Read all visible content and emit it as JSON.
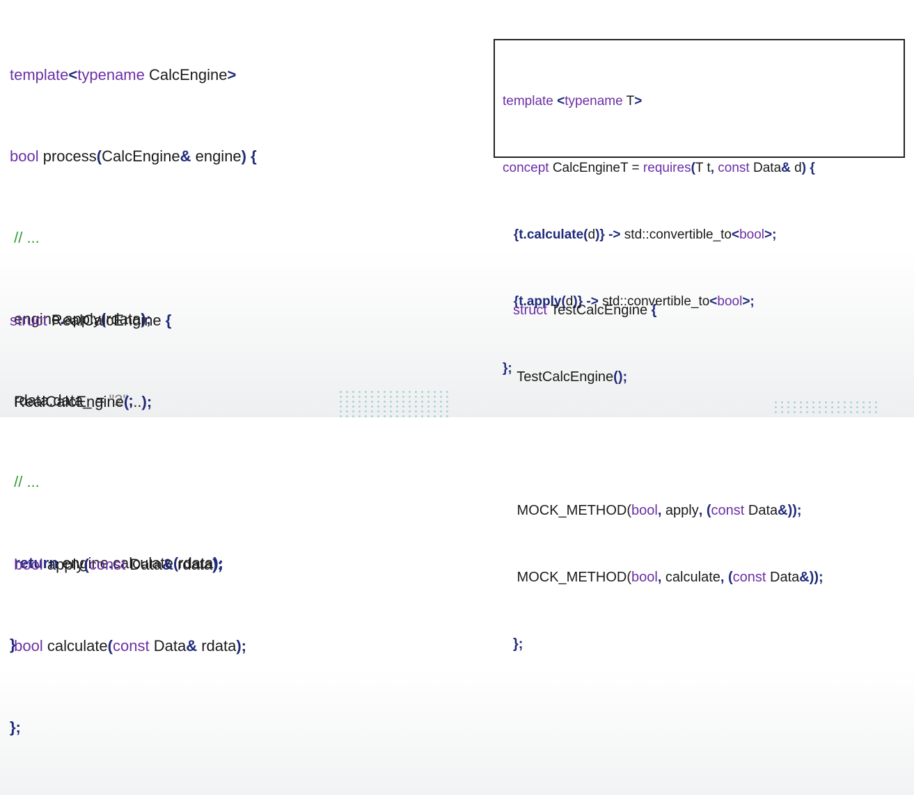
{
  "process_fn": {
    "l1": {
      "a": "template",
      "b": "<",
      "c": "typename",
      "d": " CalcEngine",
      "e": ">"
    },
    "l2": {
      "a": "bool",
      "b": " process",
      "c": "(",
      "d": "CalcEngine",
      "e": "&",
      "f": " engine",
      "g": ") {"
    },
    "l3": {
      "a": " // ..."
    },
    "l4": {
      "a": " engine",
      "b": ".",
      "c": "apply",
      "d": "(",
      "e": "rdata",
      "f": ");"
    },
    "l5": {
      "a": " rdata.data_ = ",
      "b": "\"2\"",
      "c": ";"
    },
    "l6": {
      "a": " // ..."
    },
    "l7": {
      "a": " return",
      "b": " engine",
      "c": ".",
      "d": "calculate",
      "e": "(",
      "f": "rdata",
      "g": ");"
    },
    "l8": {
      "a": "}"
    }
  },
  "concept_box": {
    "l1": {
      "a": "template ",
      "b": "<",
      "c": "typename",
      "d": " T",
      "e": ">"
    },
    "l2": {
      "a": "concept",
      "b": " CalcEngineT = ",
      "c": "requires",
      "d": "(",
      "e": "T t",
      "f": ", ",
      "g": "const",
      "h": " Data",
      "i": "&",
      "j": " d",
      "k": ") {"
    },
    "l3": {
      "a": "   {",
      "b": "t.calculate",
      "c": "(",
      "d": "d",
      "e": ")}",
      "f": " -> ",
      "g": "std::convertible_to",
      "h": "<",
      "i": "bool",
      "j": ">;"
    },
    "l4": {
      "a": "   {",
      "b": "t.apply",
      "c": "(",
      "d": "d",
      "e": ")}",
      "f": " -> ",
      "g": "std::convertible_to",
      "h": "<",
      "i": "bool",
      "j": ">;"
    },
    "l5": {
      "a": "};"
    }
  },
  "real_engine": {
    "l1": {
      "a": "struct",
      "b": " RealCalcEngine ",
      "c": "{"
    },
    "l2": {
      "a": " RealCalcEngine",
      "b": "(",
      "c": "...",
      "d": ");"
    },
    "l3": {
      "a": " "
    },
    "l4": {
      "a": " bool",
      "b": " apply",
      "c": "(",
      "d": "const",
      "e": " Data",
      "f": "&",
      "g": " rdata",
      "h": ");"
    },
    "l5": {
      "a": " bool",
      "b": " calculate",
      "c": "(",
      "d": "const",
      "e": " Data",
      "f": "&",
      "g": " rdata",
      "h": ");"
    },
    "l6": {
      "a": "};"
    }
  },
  "test_engine": {
    "l1": {
      "a": "struct",
      "b": " TestCalcEngine ",
      "c": "{"
    },
    "l2": {
      "a": " TestCalcEngine",
      "b": "();"
    },
    "l3": {
      "a": " "
    },
    "l4": {
      "a": " MOCK_METHOD(",
      "b": "bool",
      "c": ",",
      "d": " apply",
      "e": ", (",
      "f": "const",
      "g": " Data",
      "h": "&));"
    },
    "l5": {
      "a": " MOCK_METHOD(",
      "b": "bool",
      "c": ",",
      "d": " calculate",
      "e": ", (",
      "f": "const",
      "g": " Data",
      "h": "&));"
    },
    "l6": {
      "a": "};"
    }
  }
}
